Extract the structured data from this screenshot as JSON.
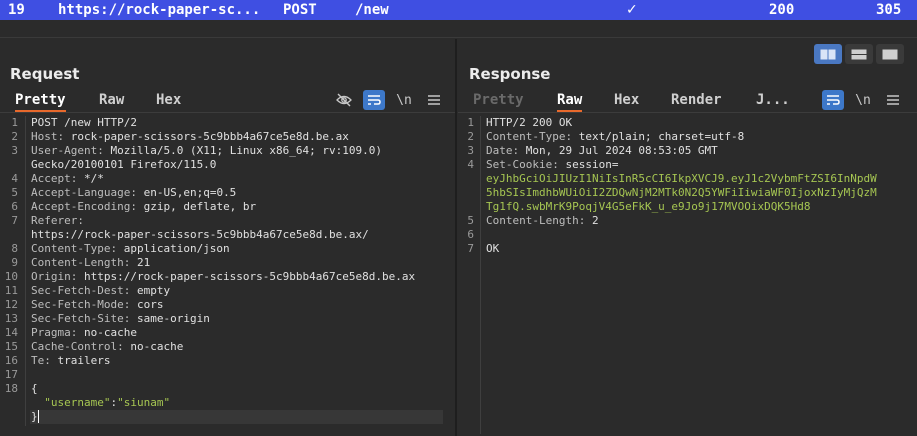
{
  "history_row": {
    "number": "19",
    "host": "https://rock-paper-sc...",
    "method": "POST",
    "path": "/new",
    "edited_icon": "checkmark-icon",
    "status": "200",
    "length": "305"
  },
  "request": {
    "title": "Request",
    "tabs": [
      "Pretty",
      "Raw",
      "Hex"
    ],
    "active_tab": "Pretty",
    "tools": [
      "hide-eye-icon",
      "wrap-icon",
      "newline-icon",
      "menu-icon"
    ],
    "newline_label": "\\n",
    "lines": [
      {
        "n": "1",
        "segs": [
          {
            "t": "POST /new HTTP/2",
            "c": "txt"
          }
        ]
      },
      {
        "n": "2",
        "segs": [
          {
            "t": "Host: ",
            "c": "hdr"
          },
          {
            "t": "rock-paper-scissors-5c9bbb4a67ce5e8d.be.ax",
            "c": "sep"
          }
        ]
      },
      {
        "n": "3",
        "segs": [
          {
            "t": "User-Agent: ",
            "c": "hdr"
          },
          {
            "t": "Mozilla/5.0 (X11; Linux x86_64; rv:109.0)",
            "c": "sep"
          }
        ]
      },
      {
        "n": "",
        "segs": [
          {
            "t": "Gecko/20100101 Firefox/115.0",
            "c": "sep"
          }
        ]
      },
      {
        "n": "4",
        "segs": [
          {
            "t": "Accept: ",
            "c": "hdr"
          },
          {
            "t": "*/*",
            "c": "sep"
          }
        ]
      },
      {
        "n": "5",
        "segs": [
          {
            "t": "Accept-Language: ",
            "c": "hdr"
          },
          {
            "t": "en-US,en;q=0.5",
            "c": "sep"
          }
        ]
      },
      {
        "n": "6",
        "segs": [
          {
            "t": "Accept-Encoding: ",
            "c": "hdr"
          },
          {
            "t": "gzip, deflate, br",
            "c": "sep"
          }
        ]
      },
      {
        "n": "7",
        "segs": [
          {
            "t": "Referer:",
            "c": "hdr"
          }
        ]
      },
      {
        "n": "",
        "segs": [
          {
            "t": "https://rock-paper-scissors-5c9bbb4a67ce5e8d.be.ax/",
            "c": "sep"
          }
        ]
      },
      {
        "n": "8",
        "segs": [
          {
            "t": "Content-Type: ",
            "c": "hdr"
          },
          {
            "t": "application/json",
            "c": "sep"
          }
        ]
      },
      {
        "n": "9",
        "segs": [
          {
            "t": "Content-Length: ",
            "c": "hdr"
          },
          {
            "t": "21",
            "c": "sep"
          }
        ]
      },
      {
        "n": "10",
        "segs": [
          {
            "t": "Origin: ",
            "c": "hdr"
          },
          {
            "t": "https://rock-paper-scissors-5c9bbb4a67ce5e8d.be.ax",
            "c": "sep"
          }
        ]
      },
      {
        "n": "11",
        "segs": [
          {
            "t": "Sec-Fetch-Dest: ",
            "c": "hdr"
          },
          {
            "t": "empty",
            "c": "sep"
          }
        ]
      },
      {
        "n": "12",
        "segs": [
          {
            "t": "Sec-Fetch-Mode: ",
            "c": "hdr"
          },
          {
            "t": "cors",
            "c": "sep"
          }
        ]
      },
      {
        "n": "13",
        "segs": [
          {
            "t": "Sec-Fetch-Site: ",
            "c": "hdr"
          },
          {
            "t": "same-origin",
            "c": "sep"
          }
        ]
      },
      {
        "n": "14",
        "segs": [
          {
            "t": "Pragma: ",
            "c": "hdr"
          },
          {
            "t": "no-cache",
            "c": "sep"
          }
        ]
      },
      {
        "n": "15",
        "segs": [
          {
            "t": "Cache-Control: ",
            "c": "hdr"
          },
          {
            "t": "no-cache",
            "c": "sep"
          }
        ]
      },
      {
        "n": "16",
        "segs": [
          {
            "t": "Te: ",
            "c": "hdr"
          },
          {
            "t": "trailers",
            "c": "sep"
          }
        ]
      },
      {
        "n": "17",
        "segs": []
      },
      {
        "n": "18",
        "segs": [
          {
            "t": "{",
            "c": "sep"
          }
        ]
      },
      {
        "n": "",
        "segs": [
          {
            "t": "  \"username\"",
            "c": "str"
          },
          {
            "t": ":",
            "c": "sep"
          },
          {
            "t": "\"siunam\"",
            "c": "str"
          }
        ]
      },
      {
        "n": "",
        "segs": [
          {
            "t": "}",
            "c": "sep"
          }
        ]
      }
    ]
  },
  "response": {
    "title": "Response",
    "tabs": [
      "Pretty",
      "Raw",
      "Hex",
      "Render",
      "J..."
    ],
    "active_tab": "Raw",
    "tools": [
      "wrap-icon",
      "newline-icon",
      "menu-icon"
    ],
    "newline_label": "\\n",
    "layout_buttons": [
      "split-vertical-icon",
      "split-horizontal-icon",
      "single-pane-icon"
    ],
    "lines": [
      {
        "n": "1",
        "segs": [
          {
            "t": "HTTP/2 200 OK",
            "c": "txt"
          }
        ]
      },
      {
        "n": "2",
        "segs": [
          {
            "t": "Content-Type: ",
            "c": "hdr"
          },
          {
            "t": "text/plain; charset=utf-8",
            "c": "sep"
          }
        ]
      },
      {
        "n": "3",
        "segs": [
          {
            "t": "Date: ",
            "c": "hdr"
          },
          {
            "t": "Mon, 29 Jul 2024 08:53:05 GMT",
            "c": "sep"
          }
        ]
      },
      {
        "n": "4",
        "segs": [
          {
            "t": "Set-Cookie: ",
            "c": "hdr"
          },
          {
            "t": "session=",
            "c": "sep"
          }
        ]
      },
      {
        "n": "",
        "segs": [
          {
            "t": "eyJhbGciOiJIUzI1NiIsInR5cCI6IkpXVCJ9.eyJ1c2VybmFtZSI6InNpdW",
            "c": "str"
          }
        ]
      },
      {
        "n": "",
        "segs": [
          {
            "t": "5hbSIsImdhbWUiOiI2ZDQwNjM2MTk0N2Q5YWFiIiwiaWF0IjoxNzIyMjQzM",
            "c": "str"
          }
        ]
      },
      {
        "n": "",
        "segs": [
          {
            "t": "Tg1fQ.swbMrK9PoqjV4G5eFkK_u_e9Jo9j17MVOOixDQK5Hd8",
            "c": "str"
          }
        ]
      },
      {
        "n": "5",
        "segs": [
          {
            "t": "Content-Length: ",
            "c": "hdr"
          },
          {
            "t": "2",
            "c": "sep"
          }
        ]
      },
      {
        "n": "6",
        "segs": []
      },
      {
        "n": "7",
        "segs": [
          {
            "t": "OK",
            "c": "sep"
          }
        ]
      }
    ]
  }
}
